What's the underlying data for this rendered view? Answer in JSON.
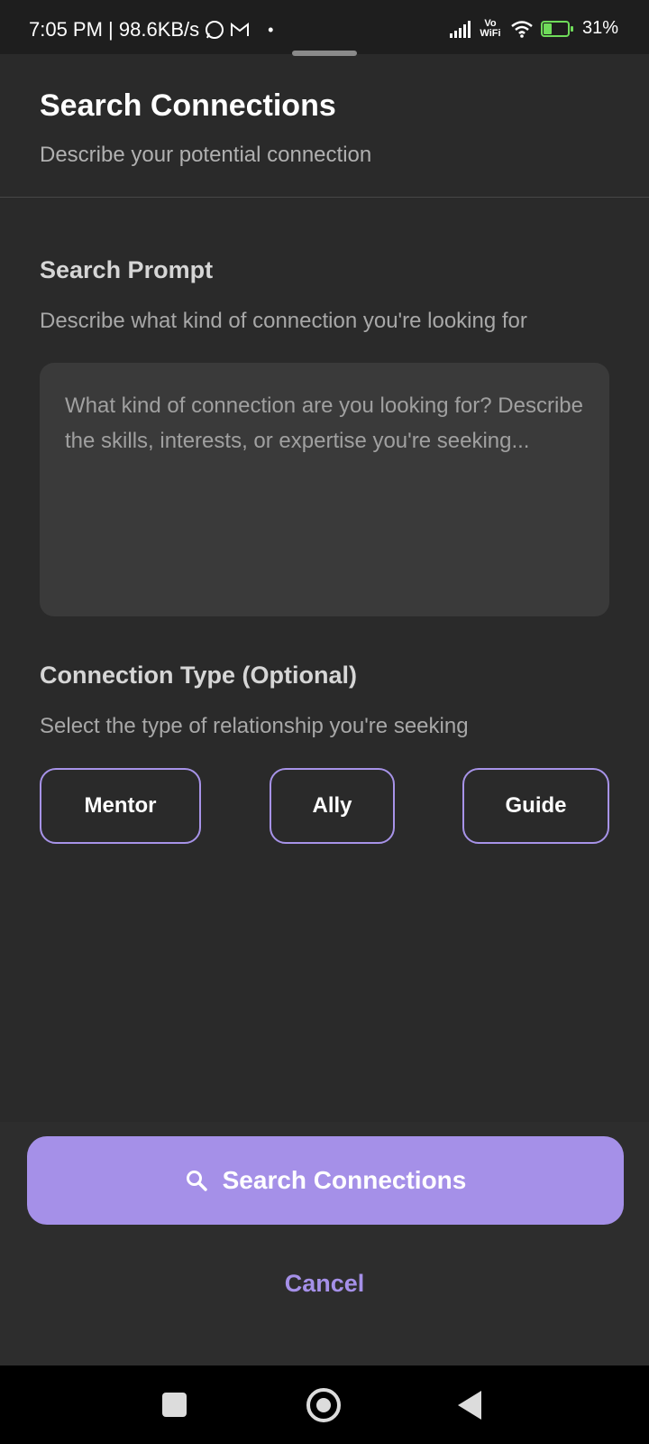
{
  "status_bar": {
    "time_info": "7:05 PM | 98.6KB/s",
    "network_label": "Vo WiFi",
    "battery_percent_text": "31%",
    "battery_level": 0.31
  },
  "header": {
    "title": "Search Connections",
    "subtitle": "Describe your potential connection"
  },
  "search_prompt": {
    "title": "Search Prompt",
    "description": "Describe what kind of connection you're looking for",
    "placeholder": "What kind of connection are you looking for? Describe the skills, interests, or expertise you're seeking...",
    "value": ""
  },
  "connection_type": {
    "title": "Connection Type (Optional)",
    "description": "Select the type of relationship you're seeking",
    "options": [
      "Mentor",
      "Ally",
      "Guide"
    ]
  },
  "actions": {
    "search_label": "Search Connections",
    "cancel_label": "Cancel"
  },
  "colors": {
    "accent": "#a590e8",
    "background": "#2a2a2a",
    "input_background": "#3a3a3a"
  },
  "icons": {
    "search_button_icon": "search-icon",
    "nav_recents": "square-icon",
    "nav_home": "circle-icon",
    "nav_back": "triangle-back-icon"
  }
}
